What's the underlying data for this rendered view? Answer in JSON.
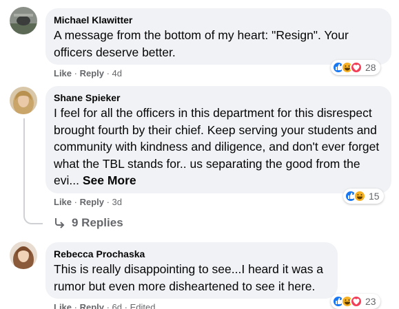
{
  "comments": [
    {
      "author": "Michael Klawitter",
      "text": "A message from the bottom of my heart: \"Resign\". Your officers deserve better.",
      "actions": {
        "like": "Like",
        "reply": "Reply",
        "time": "4d"
      },
      "reactions": {
        "icons": [
          "like-icon",
          "haha-icon",
          "love-icon"
        ],
        "count": "28"
      }
    },
    {
      "author": "Shane Spieker",
      "text": "I feel for all the officers in this department for this disrespect brought fourth by their chief. Keep serving your students and community with kindness and diligence, and don't ever forget what the TBL stands for.. us separating the good from the evi...",
      "see_more": "See More",
      "actions": {
        "like": "Like",
        "reply": "Reply",
        "time": "3d"
      },
      "reactions": {
        "icons": [
          "like-icon",
          "haha-icon"
        ],
        "count": "15"
      },
      "replies_label": "9 Replies"
    },
    {
      "author": "Rebecca Prochaska",
      "text": "This is really disappointing to see...I heard it was a rumor but even more disheartened to see it here.",
      "actions": {
        "like": "Like",
        "reply": "Reply",
        "time": "6d",
        "edited": "Edited"
      },
      "reactions": {
        "icons": [
          "like-icon",
          "haha-icon",
          "love-icon"
        ],
        "count": "23"
      }
    }
  ],
  "colors": {
    "bubble": "#f0f2f5",
    "meta": "#65676b",
    "like_blue": "#1877f2",
    "love_red": "#f33e58",
    "haha_yellow": "#f7b125"
  }
}
